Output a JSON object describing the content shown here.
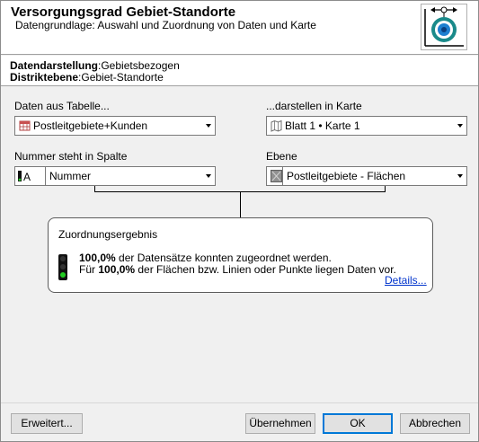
{
  "header": {
    "title": "Versorgungsgrad Gebiet-Standorte",
    "subtitle": "Datengrundlage: Auswahl und Zuordnung von Daten und Karte",
    "logo_icon": "target-range-icon"
  },
  "info": {
    "darstellung_label": "Datendarstellung",
    "darstellung_value": ":Gebietsbezogen",
    "distrikt_label": "Distriktebene",
    "distrikt_value": ":Gebiet-Standorte"
  },
  "form": {
    "table_label": "Daten aus Tabelle...",
    "table_value": "Postleitgebiete+Kunden",
    "table_icon": "table-icon",
    "map_label": "...darstellen in Karte",
    "map_value": "Blatt 1 • Karte 1",
    "map_icon": "map-icon",
    "column_label": "Nummer steht in Spalte",
    "column_value": "Nummer",
    "column_icon": "text-column-icon",
    "layer_label": "Ebene",
    "layer_value": "Postleitgebiete - Flächen",
    "layer_icon": "area-layer-icon"
  },
  "result": {
    "title": "Zuordnungsergebnis",
    "line1_value": "100,0%",
    "line1_text": " der Datensätze konnten zugeordnet werden.",
    "line2_prefix": "Für ",
    "line2_value": "100,0%",
    "line2_text": " der Flächen bzw. Linien oder Punkte liegen Daten vor.",
    "details_link": "Details...",
    "status_color": "#22cc22"
  },
  "buttons": {
    "advanced": "Erweitert...",
    "apply": "Übernehmen",
    "ok": "OK",
    "cancel": "Abbrechen"
  },
  "colors": {
    "accent": "#0078d7",
    "link": "#0033cc",
    "logo_teal": "#1a8a8a",
    "logo_blue": "#1e7fd0"
  }
}
